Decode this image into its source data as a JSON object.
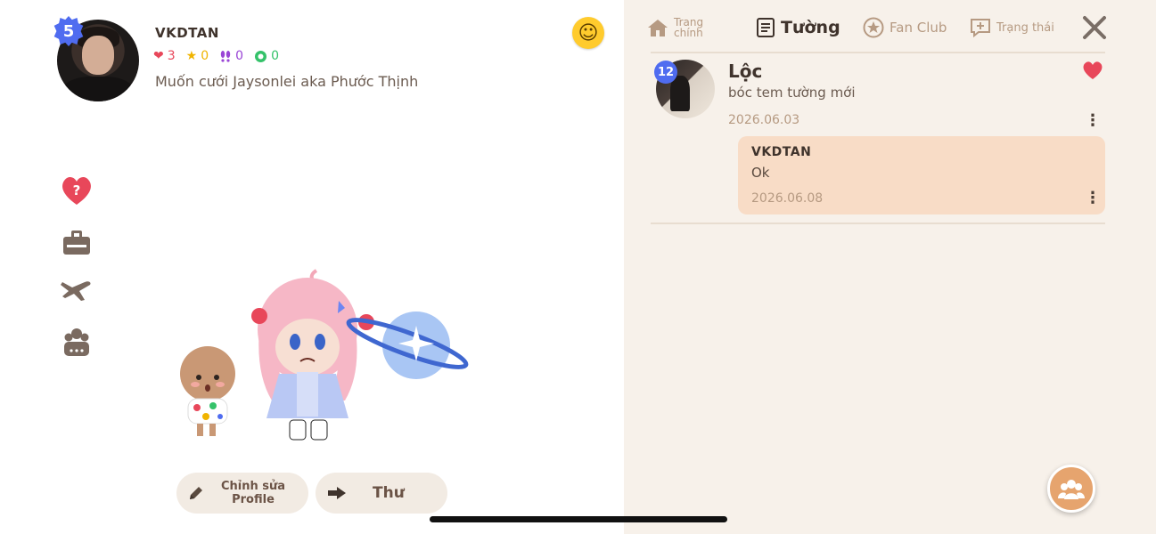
{
  "profile": {
    "level": "5",
    "username": "VKDTAN",
    "stats": {
      "hearts": "3",
      "stars": "0",
      "footprints": "0",
      "clovers": "0"
    },
    "bio": "Muốn cưới Jaysonlei aka Phước Thịnh"
  },
  "emoji_button": {
    "icon": "smiley-icon",
    "glyph": "☺"
  },
  "side_menu": [
    {
      "name": "heart-question-icon",
      "color": "#e8475a"
    },
    {
      "name": "id-card-icon",
      "color": "#7a6a60"
    },
    {
      "name": "airplane-icon",
      "color": "#7a6a60"
    },
    {
      "name": "group-icon",
      "color": "#7a6a60"
    }
  ],
  "actions": {
    "edit_label": "Chỉnh sửa Profile",
    "mail_label": "Thư"
  },
  "tabs": {
    "home": "Trang chính",
    "wall": "Tường",
    "fanclub": "Fan Club",
    "status": "Trạng thái"
  },
  "post": {
    "level": "12",
    "name": "Lộc",
    "text": "bóc tem tường mới",
    "date": "2026.06.03",
    "liked": true
  },
  "reply": {
    "name": "VKDTAN",
    "text": "Ok",
    "date": "2026.06.08"
  },
  "colors": {
    "accent": "#4f6cf0",
    "wall_bg": "#f7f1ea",
    "reply_bg": "#f8dcc6",
    "fab": "#e6a46e",
    "heart": "#e8475a"
  }
}
